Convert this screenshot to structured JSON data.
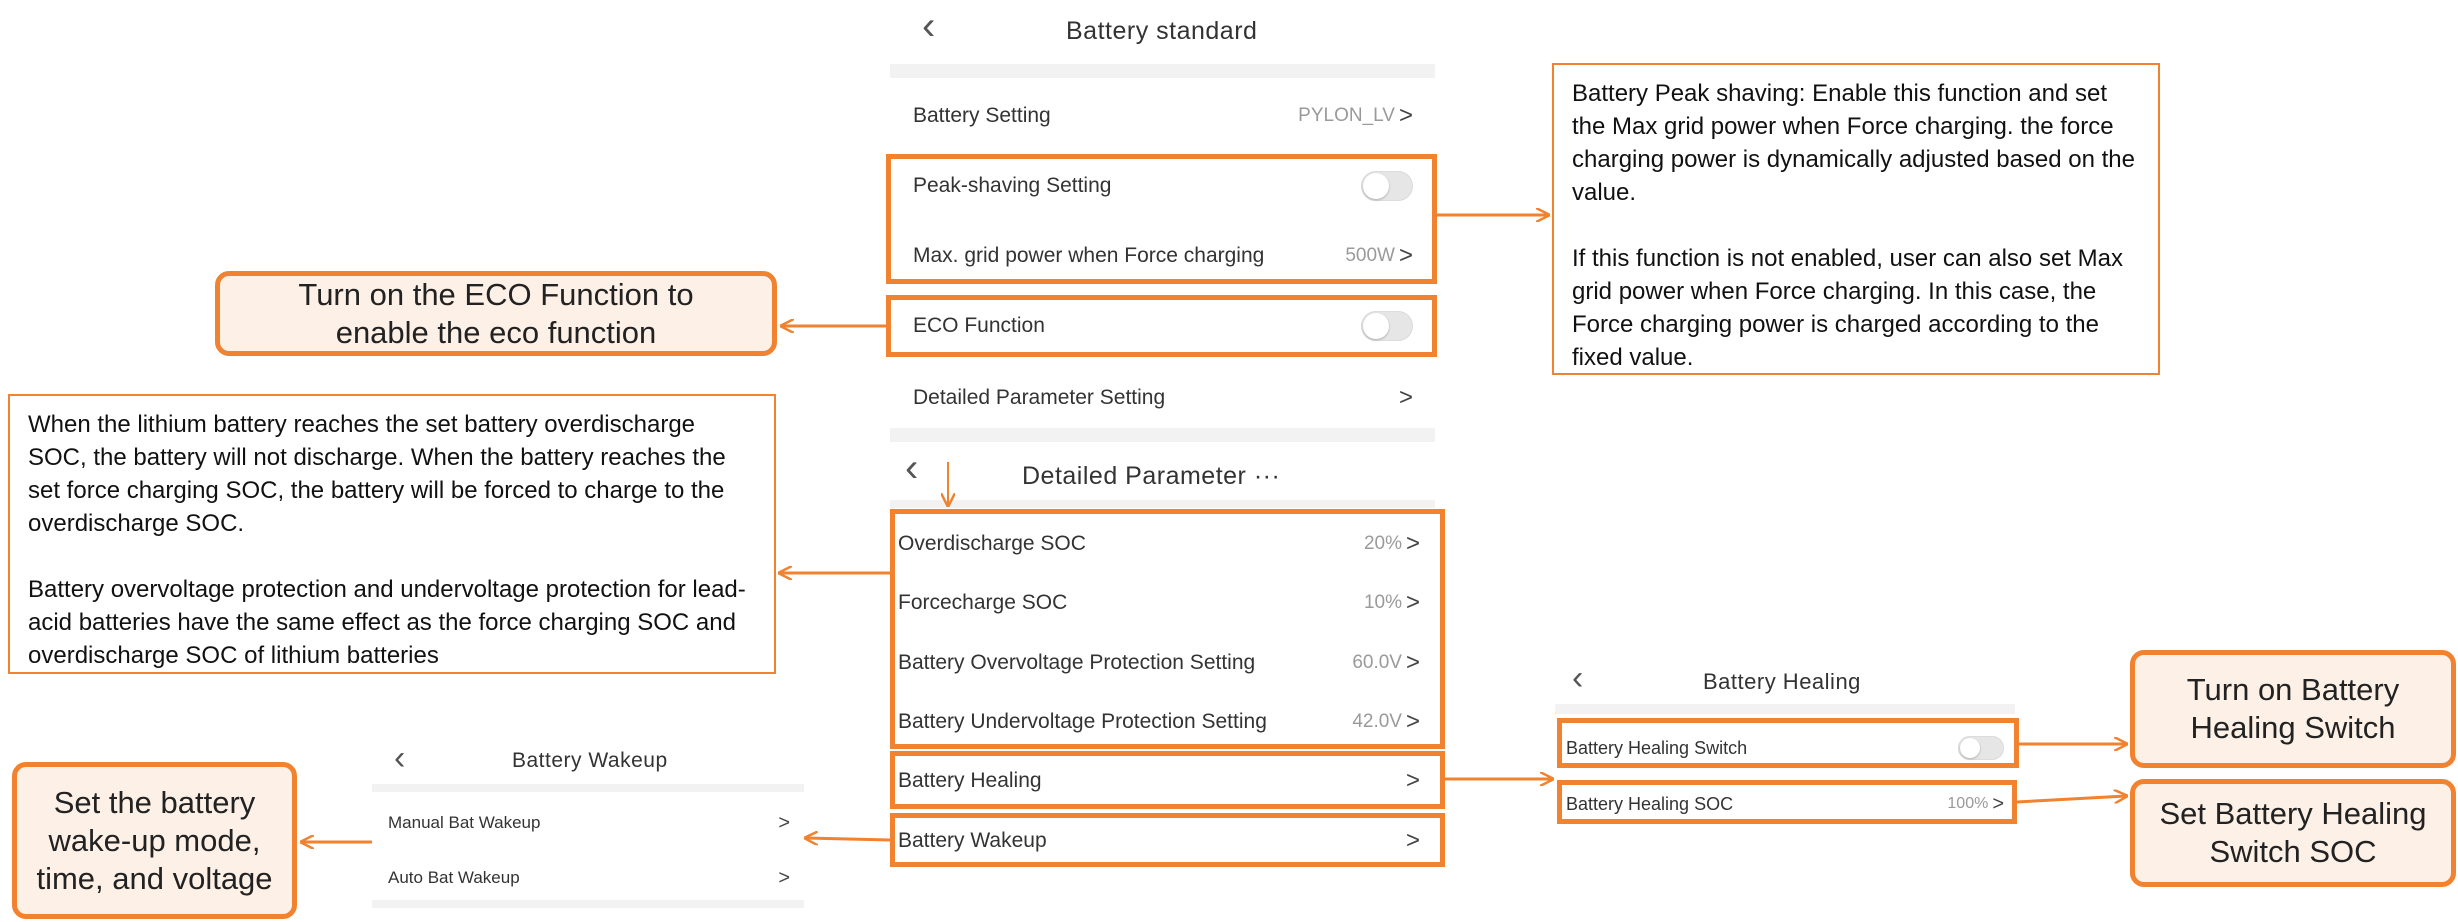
{
  "colors": {
    "accent": "#f08230",
    "callout_fill": "#fdf0e6"
  },
  "battery_standard": {
    "title": "Battery standard",
    "back_icon": "chevron-left-icon",
    "rows": {
      "battery_setting": {
        "label": "Battery Setting",
        "value": "PYLON_LV"
      },
      "peak_shaving": {
        "label": "Peak-shaving Setting",
        "toggle": "off"
      },
      "max_grid": {
        "label": "Max. grid power when Force charging",
        "value": "500W"
      },
      "eco": {
        "label": "ECO Function",
        "toggle": "off"
      },
      "detailed": {
        "label": "Detailed Parameter Setting"
      }
    }
  },
  "detailed_parameter": {
    "title": "Detailed  Parameter ···",
    "rows": {
      "overdischarge": {
        "label": "Overdischarge SOC",
        "value": "20%"
      },
      "forcecharge": {
        "label": "Forcecharge SOC",
        "value": "10%"
      },
      "overvoltage": {
        "label": "Battery Overvoltage Protection Setting",
        "value": "60.0V"
      },
      "undervoltage": {
        "label": "Battery Undervoltage Protection Setting",
        "value": "42.0V"
      },
      "healing": {
        "label": "Battery Healing"
      },
      "wakeup": {
        "label": "Battery Wakeup"
      }
    }
  },
  "battery_healing": {
    "title": "Battery  Healing",
    "rows": {
      "switch": {
        "label": "Battery Healing Switch",
        "toggle": "off"
      },
      "soc": {
        "label": "Battery Healing SOC",
        "value": "100%"
      }
    }
  },
  "battery_wakeup": {
    "title": "Battery  Wakeup",
    "rows": {
      "manual": {
        "label": "Manual Bat Wakeup"
      },
      "auto": {
        "label": "Auto Bat Wakeup"
      }
    }
  },
  "callouts": {
    "peak_shaving_p1": "Battery Peak shaving: Enable this function and set the Max grid power when Force charging. the force charging power is dynamically adjusted based on the value.",
    "peak_shaving_p2": "If this function is not enabled, user can also set Max grid power when Force charging. In this case, the Force charging power is charged according to the fixed value.",
    "eco": "Turn on the ECO Function to enable the eco function",
    "soc_p1": "When the lithium battery reaches the set battery overdischarge SOC, the battery will not discharge. When the battery reaches the set force charging SOC, the battery will be forced to charge to the overdischarge SOC.",
    "soc_p2": "Battery overvoltage protection and undervoltage protection for lead-acid batteries have the same effect as the force charging SOC and overdischarge SOC of lithium batteries",
    "wakeup": "Set the battery wake-up mode, time, and voltage",
    "healing_switch": "Turn on Battery Healing Switch",
    "healing_soc": "Set Battery Healing Switch SOC"
  },
  "chevron_glyph": ">"
}
